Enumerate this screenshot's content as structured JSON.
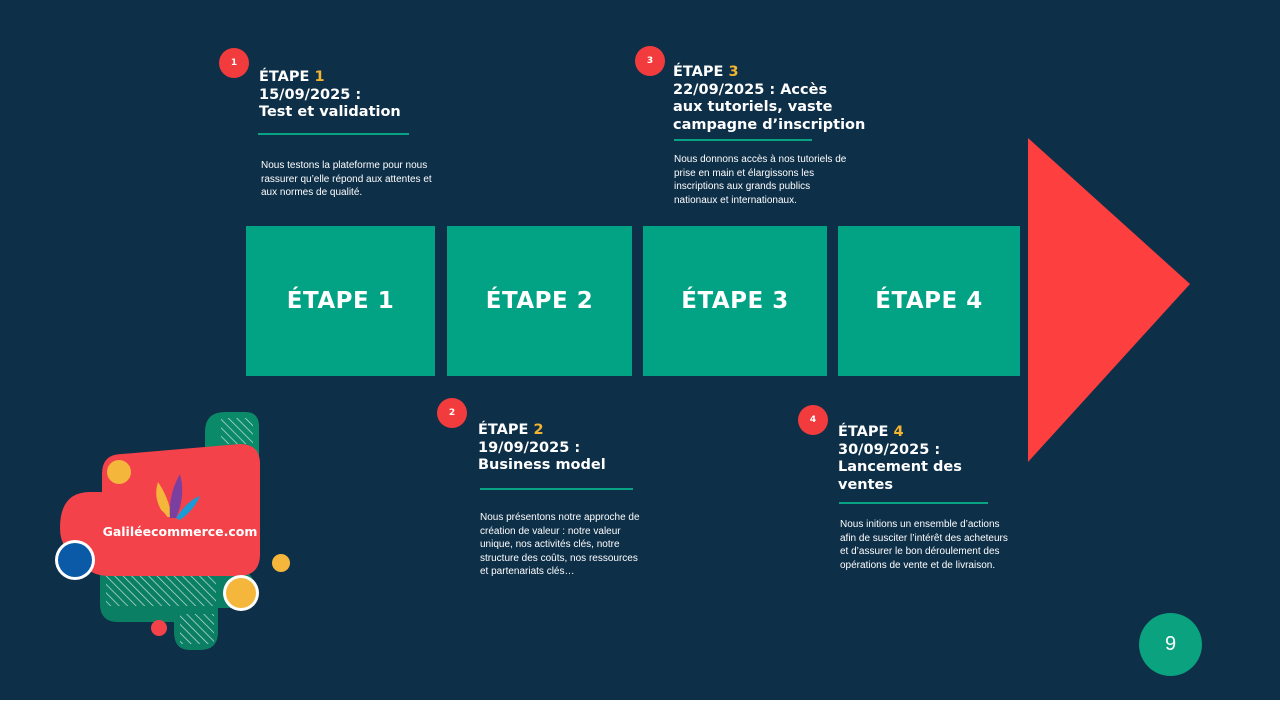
{
  "page_number": "9",
  "steps": [
    {
      "dot": "1",
      "head_word": "ÉTAPE",
      "head_num": "1",
      "head_lines": [
        "15/09/2025 :",
        "Test et validation"
      ],
      "desc_lines": [
        "Nous testons la plateforme pour nous",
        "rassurer qu’elle répond aux attentes et",
        "aux normes de qualité."
      ]
    },
    {
      "dot": "2",
      "head_word": "ÉTAPE",
      "head_num": "2",
      "head_lines": [
        "19/09/2025 :",
        "Business model"
      ],
      "desc_lines": [
        "Nous présentons notre approche de",
        "création de valeur : notre valeur",
        "unique, nos activités clés, notre",
        "structure des coûts, nos ressources",
        "et partenariats clés…"
      ]
    },
    {
      "dot": "3",
      "head_word": "ÉTAPE",
      "head_num": "3",
      "head_lines": [
        "22/09/2025 : Accès",
        "aux tutoriels, vaste",
        "campagne d’inscription"
      ],
      "desc_lines": [
        "Nous donnons accès à nos tutoriels de",
        "prise en main et élargissons les",
        "inscriptions aux grands publics",
        "nationaux et internationaux."
      ]
    },
    {
      "dot": "4",
      "head_word": "ÉTAPE",
      "head_num": "4",
      "head_lines": [
        "30/09/2025 :",
        "Lancement des",
        "ventes"
      ],
      "desc_lines": [
        "Nous initions un ensemble d’actions",
        "afin de susciter l’intérêt des acheteurs",
        "et d’assurer le bon déroulement des",
        "opérations de vente et de livraison."
      ]
    }
  ],
  "boxes": [
    "ÉTAPE 1",
    "ÉTAPE 2",
    "ÉTAPE 3",
    "ÉTAPE 4"
  ],
  "logo": {
    "text": "Galiléecommerce.com"
  },
  "colors": {
    "background": "#0e2f48",
    "box": "#02a385",
    "arrow": "#fe3f40",
    "dot": "#f23b3d",
    "highlight": "#f2b431"
  }
}
